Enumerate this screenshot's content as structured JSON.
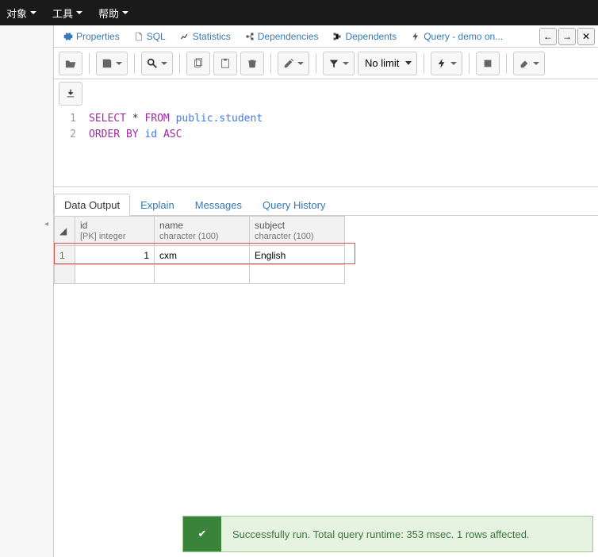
{
  "menu": {
    "object": "对象",
    "tools": "工具",
    "help": "帮助"
  },
  "tabs": {
    "properties": "Properties",
    "sql": "SQL",
    "statistics": "Statistics",
    "dependencies": "Dependencies",
    "dependents": "Dependents",
    "query": "Query - demo on..."
  },
  "toolbar": {
    "limit": "No limit"
  },
  "editor": {
    "lines": [
      "1",
      "2"
    ],
    "l1": {
      "kw1": "SELECT",
      "star": "*",
      "kw2": "FROM",
      "ident": "public.student"
    },
    "l2": {
      "kw1": "ORDER BY",
      "ident": "id",
      "kw2": "ASC"
    }
  },
  "resultTabs": {
    "data": "Data Output",
    "explain": "Explain",
    "messages": "Messages",
    "history": "Query History"
  },
  "columns": [
    {
      "name": "id",
      "type": "[PK] integer"
    },
    {
      "name": "name",
      "type": "character (100)"
    },
    {
      "name": "subject",
      "type": "character (100)"
    }
  ],
  "rows": [
    {
      "n": "1",
      "id": "1",
      "name": "cxm",
      "subject": "English"
    }
  ],
  "status": "Successfully run. Total query runtime: 353 msec. 1 rows affected."
}
